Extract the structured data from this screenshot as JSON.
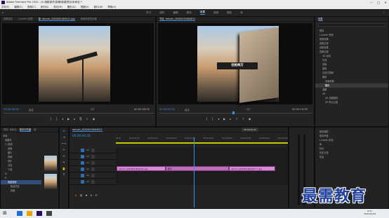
{
  "window": {
    "title": "Adobe Premiere Pro 2020 - D:\\电影制作\\剪辑\\新建项目\\未命名 *",
    "controls": [
      "—",
      "□",
      "✕"
    ]
  },
  "menus": [
    "文件(F)",
    "编辑(E)",
    "剪辑(C)",
    "序列(S)",
    "标记(M)",
    "图形(G)",
    "视图(V)",
    "窗口(W)",
    "帮助(H)"
  ],
  "workspaces": [
    "学习",
    "组件",
    "编辑",
    "颜色",
    "效果",
    "音频",
    "图形",
    "库"
  ],
  "workspace_active": "效果",
  "source_panel": {
    "tabs": [
      "效果控件",
      "Lumetri 范围",
      "源: rehuoh_2020051909411.jpg",
      "音频剪辑混合器"
    ],
    "timecode_left": "00:00:00:00",
    "fit": "适合",
    "timecode_right": "00:00:05:00",
    "scale": "1/2"
  },
  "program_panel": {
    "tabs": [
      "节目: rehuoh_20200519094011"
    ],
    "timecode_left": "00:00:04:20",
    "fit": "适合",
    "timecode_right": "00:00:10:00",
    "scale": "1/2",
    "overlay_text": "往柏林方"
  },
  "effects_panel": {
    "title": "效果",
    "items": [
      "预设",
      "Lumetri 预设",
      "音频效果",
      "音频过渡",
      "视频效果",
      "视频过渡",
      "3D 运动",
      "内滑",
      "划像",
      "擦除",
      "沉浸式视频",
      "缩放",
      "页面剥落",
      "翻页",
      "溶解",
      "VR",
      "VR 光圈擦除",
      "VR 默认过渡"
    ],
    "selected_item": "翻页"
  },
  "right_lower_panel": {
    "items": [
      "基本图形",
      "基本声音",
      "Lumetri 颜色",
      "库",
      "标记",
      "历史记录",
      "信息"
    ]
  },
  "project_panel": {
    "tabs": [
      "项目: 未命名",
      "媒体浏览器",
      "库"
    ],
    "tree": [
      "本地",
      "收藏夹",
      "C:\\系统",
      "桌面",
      "图片",
      "视频",
      "音乐",
      "文档",
      "下载",
      "D:",
      "E:",
      "电影制作",
      "新建项目",
      "剪辑"
    ],
    "selected": "电影制作"
  },
  "timeline": {
    "tab": "rehuoh_20200519094011",
    "timecode": "00:00:04:20",
    "ruler": [
      "00:00",
      "00:00:01:00",
      "00:00:02:00",
      "00:00:03:00",
      "00:00:04:00",
      "00:00:05:00",
      "00:00:06:00",
      "00:00:07:00",
      "00:00:08:00",
      "00:00:09:00",
      "00:00:10:00"
    ],
    "tracks": [
      "V3",
      "V2",
      "V1",
      "A1",
      "A2",
      "A3"
    ],
    "clips": [
      {
        "name": "rehuoh_20200519094011.jpg"
      },
      {
        "name": "翻页"
      },
      {
        "name": "rehuoh_20200519094017 1.jpg"
      }
    ],
    "tooltip": "00:00:04:20"
  },
  "watermark": "最需教育",
  "taskbar": {
    "time": "8:21",
    "date": "2021/10/15"
  },
  "colors": {
    "accent": "#3a8ff0",
    "clip": "#d889d8",
    "audio": "#4aa64a"
  }
}
